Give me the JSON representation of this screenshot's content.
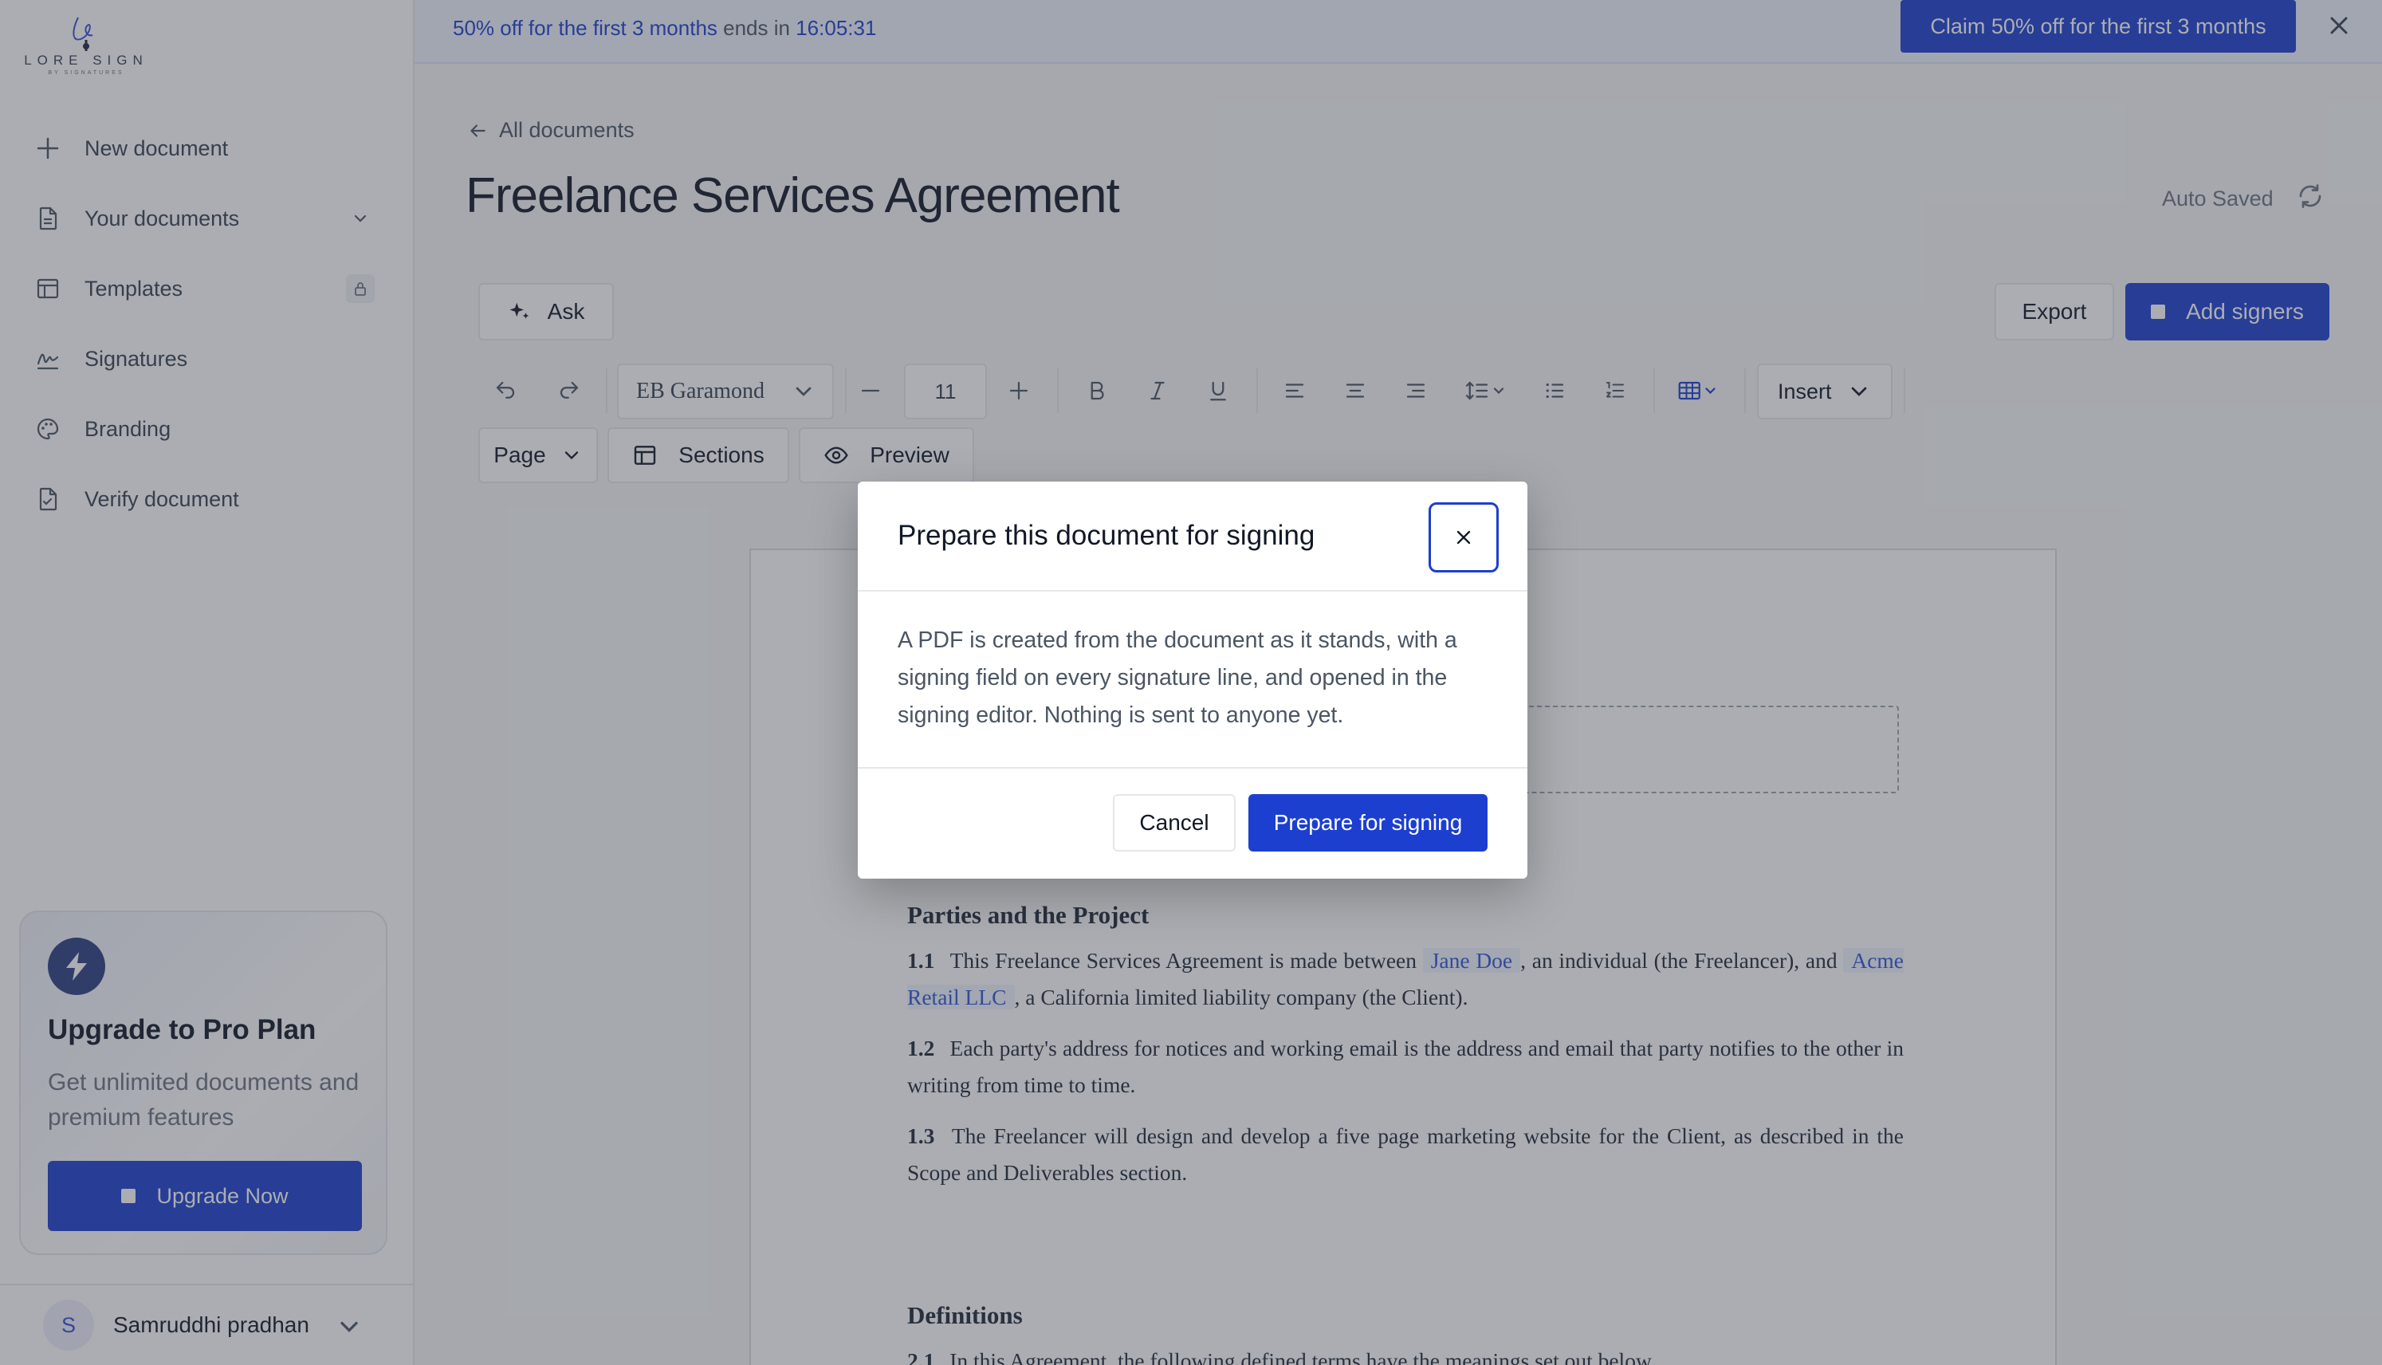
{
  "brand": {
    "logo_text": "LORE SIGN",
    "logo_sub": "BY SIGNATURES"
  },
  "sidebar": {
    "items": [
      {
        "label": "New document",
        "icon": "plus-icon"
      },
      {
        "label": "Your documents",
        "icon": "document-icon"
      },
      {
        "label": "Templates",
        "icon": "layout-icon"
      },
      {
        "label": "Signatures",
        "icon": "signature-icon"
      },
      {
        "label": "Branding",
        "icon": "palette-icon"
      },
      {
        "label": "Verify document",
        "icon": "verify-document-icon"
      }
    ],
    "upgrade": {
      "title": "Upgrade to Pro Plan",
      "description": "Get unlimited documents and premium features",
      "button": "Upgrade Now"
    },
    "user": {
      "initial": "S",
      "name": "Samruddhi pradhan"
    }
  },
  "banner": {
    "offer": "50% off for the first 3 months",
    "ends_in": "ends in",
    "countdown": "16:05:31",
    "claim_button": "Claim 50% off for the first 3 months"
  },
  "header": {
    "back_label": "All documents",
    "title": "Freelance Services Agreement",
    "save_status": "Auto Saved",
    "ask_button": "Ask",
    "export_button": "Export",
    "add_signers_button": "Add signers"
  },
  "toolbar": {
    "font_family": "EB Garamond",
    "font_size": "11",
    "insert_label": "Insert",
    "page_label": "Page",
    "sections_label": "Sections",
    "preview_label": "Preview"
  },
  "document": {
    "section1": {
      "heading": "Parties and the Project",
      "c1_num": "1.1",
      "c1_pre": "This Freelance Services Agreement is made between",
      "c1_party1": "Jane Doe",
      "c1_mid": ", an individual (the Freelancer), and",
      "c1_party2": "Acme Retail LLC",
      "c1_post": ", a California limited liability company (the Client).",
      "c2_num": "1.2",
      "c2_text": "Each party's address for notices and working email is the address and email that party notifies to the other in writing from time to time.",
      "c3_num": "1.3",
      "c3_text": "The Freelancer will design and develop a five page marketing website for the Client, as described in the Scope and Deliverables section."
    },
    "section2": {
      "heading": "Definitions",
      "c1_num": "2.1",
      "c1_text": "In this Agreement, the following defined terms have the meanings set out below."
    }
  },
  "modal": {
    "title": "Prepare this document for signing",
    "body": "A PDF is created from the document as it stands, with a signing field on every signature line, and opened in the signing editor. Nothing is sent to anyone yet.",
    "cancel": "Cancel",
    "confirm": "Prepare for signing"
  },
  "colors": {
    "accent": "#1d3fcf",
    "banner_bg": "#eff3fe",
    "party_text": "#2f55d4"
  }
}
